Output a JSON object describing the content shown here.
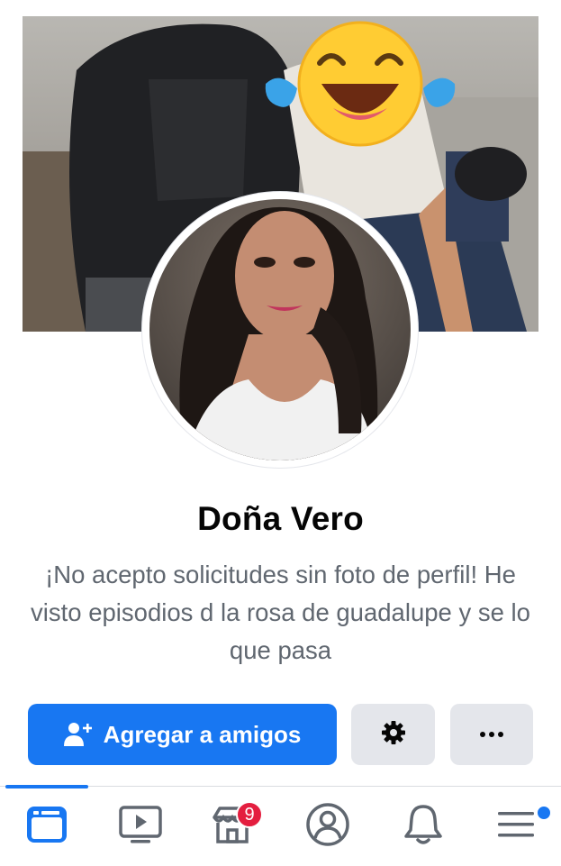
{
  "profile": {
    "name": "Doña Vero",
    "bio": "¡No acepto solicitudes sin foto de perfil! He visto episodios d la rosa de guadalupe y se lo que pasa"
  },
  "actions": {
    "add_friend_label": "Agregar a amigos",
    "add_friend_icon": "person-add-icon",
    "settings_icon": "gear-icon",
    "more_icon": "ellipsis-icon"
  },
  "tabbar": {
    "active": "news-feed",
    "tabs": [
      {
        "name": "news-feed",
        "icon": "feed-icon"
      },
      {
        "name": "watch",
        "icon": "video-icon"
      },
      {
        "name": "marketplace",
        "icon": "store-icon",
        "badge": "9"
      },
      {
        "name": "profile",
        "icon": "user-circle-icon"
      },
      {
        "name": "notifications",
        "icon": "bell-icon"
      },
      {
        "name": "menu",
        "icon": "hamburger-icon"
      }
    ]
  },
  "colors": {
    "brand": "#1877f2",
    "badge": "#e41e3f",
    "secondary_button": "#e4e6eb",
    "muted_text": "#606770"
  }
}
